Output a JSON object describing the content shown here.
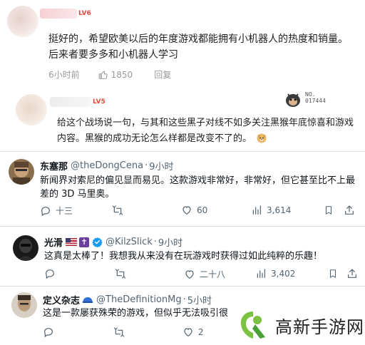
{
  "forum": {
    "comment1": {
      "level": "LV6",
      "text": "挺好的，希望欧美以后的年度游戏都能拥有小机器人的热度和销量。后来者要多多和小机器人学习",
      "time": "6小时前",
      "likes": "1850",
      "reply_label": "回复"
    },
    "comment2": {
      "level": "LV5",
      "badge_no": "NO.",
      "badge_id": "017444",
      "text": "给这个战场说一句，与其和这些黑子对线不如多关注黑猴年底惊喜和游戏内容。黑猴的成功无论怎么样都是改变不了的。"
    }
  },
  "tweets": [
    {
      "name": "东塞那",
      "handle": "@theDongCena",
      "time": "9小时",
      "text": "新闻界对索尼的偏见显而易见。这款游戏非常好，非常好，但它甚至比不上最差的 3D 马里奥。",
      "replies": "十三",
      "likes": "60",
      "views": "3,614"
    },
    {
      "name": "光滑",
      "handle": "@KilzSlick",
      "time": "9小时",
      "text": "这真是太棒了！我想我从来没有在玩游戏时获得过如此纯粹的乐趣！",
      "likes": "二十八",
      "views": "3,402"
    },
    {
      "name": "定义杂志",
      "handle": "@TheDefinitionMg",
      "time": "5小时",
      "text": "这是一款屡获殊荣的游戏，但似乎无法吸引很",
      "likes": "2"
    }
  ],
  "watermark": {
    "text": "高新手游网"
  },
  "colors": {
    "accent_blue": "#1d9bf0",
    "muted": "#536471",
    "forum_level": "#e8463b",
    "watermark_green": "#7cc242"
  }
}
